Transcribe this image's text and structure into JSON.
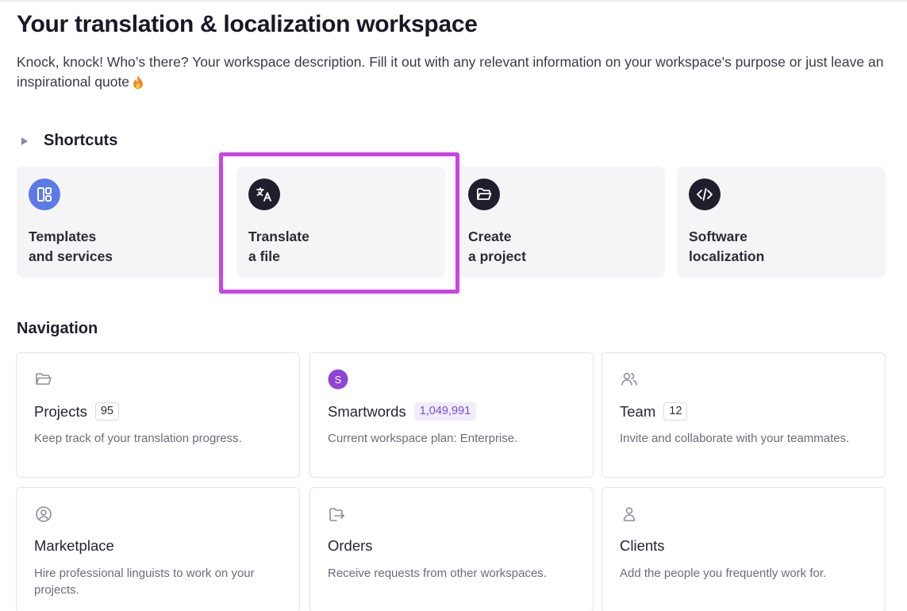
{
  "header": {
    "title": "Your translation & localization workspace",
    "description": "Knock, knock! Who’s there? Your workspace description. Fill it out with any relevant information on your workspace's purpose or just leave an inspirational quote"
  },
  "shortcuts": {
    "title": "Shortcuts",
    "items": [
      {
        "line1": "Templates",
        "line2": "and services",
        "icon": "templates-icon",
        "icon_bg": "#5b7ae8"
      },
      {
        "line1": "Translate",
        "line2": "a file",
        "icon": "translate-icon",
        "icon_bg": "#1e1e2d"
      },
      {
        "line1": "Create",
        "line2": "a project",
        "icon": "folder-open-icon",
        "icon_bg": "#1e1e2d"
      },
      {
        "line1": "Software",
        "line2": "localization",
        "icon": "code-icon",
        "icon_bg": "#1e1e2d"
      }
    ],
    "highlight_color": "#c944e6"
  },
  "navigation": {
    "title": "Navigation",
    "items": [
      {
        "name": "Projects",
        "count": "95",
        "desc": "Keep track of your translation progress.",
        "icon": "folder-icon"
      },
      {
        "name": "Smartwords",
        "count": "1,049,991",
        "desc": "Current workspace plan: Enterprise.",
        "icon": "smartwords-icon",
        "icon_letter": "S"
      },
      {
        "name": "Team",
        "count": "12",
        "desc": "Invite and collaborate with your teammates.",
        "icon": "team-icon"
      },
      {
        "name": "Marketplace",
        "desc": "Hire professional linguists to work on your projects.",
        "icon": "marketplace-icon"
      },
      {
        "name": "Orders",
        "desc": "Receive requests from other workspaces.",
        "icon": "orders-icon"
      },
      {
        "name": "Clients",
        "desc": "Add the people you frequently work for.",
        "icon": "clients-icon"
      }
    ]
  },
  "colors": {
    "accent_purple": "#7d4cdb",
    "smartwords_badge": "#8e44d6",
    "card_bg": "#f5f5f7"
  }
}
